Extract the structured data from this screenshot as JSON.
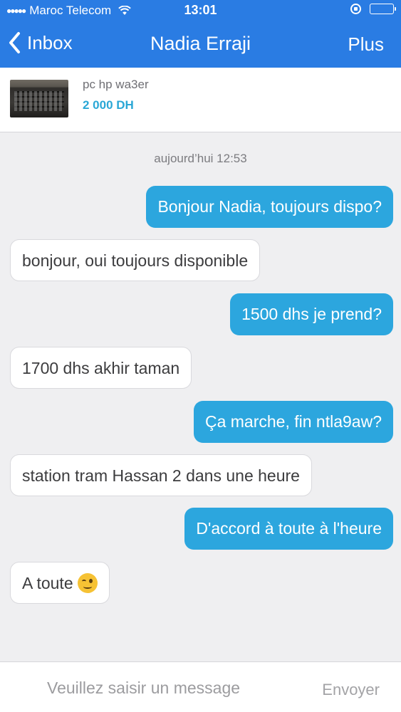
{
  "status_bar": {
    "carrier": "Maroc Telecom",
    "time": "13:01",
    "signal_dots": "●●●●●",
    "wifi_icon": "wifi-icon",
    "battery_level": 0.95
  },
  "nav": {
    "back_label": "Inbox",
    "title": "Nadia Erraji",
    "more_label": "Plus"
  },
  "listing": {
    "title": "pc hp wa3er",
    "price": "2 000 DH"
  },
  "conversation": {
    "date_label": "aujourd’hui 12:53",
    "messages": [
      {
        "direction": "out",
        "text": "Bonjour Nadia, toujours dispo?"
      },
      {
        "direction": "in",
        "text": "bonjour, oui toujours disponible"
      },
      {
        "direction": "out",
        "text": "1500 dhs je prend?"
      },
      {
        "direction": "in",
        "text": "1700 dhs akhir taman"
      },
      {
        "direction": "out",
        "text": "Ça marche, fin ntla9aw?"
      },
      {
        "direction": "in",
        "text": "station tram Hassan 2 dans une heure"
      },
      {
        "direction": "out",
        "text": "D'accord à toute à l'heure"
      },
      {
        "direction": "in",
        "text": "A toute",
        "emoji": "winking-face"
      }
    ]
  },
  "composer": {
    "placeholder": "Veuillez saisir un message",
    "value": "",
    "send_label": "Envoyer"
  },
  "colors": {
    "header": "#2a7ce3",
    "outgoing_bubble": "#2ca6de",
    "incoming_bubble": "#ffffff",
    "price": "#2aa7d6",
    "background": "#efeff1"
  }
}
